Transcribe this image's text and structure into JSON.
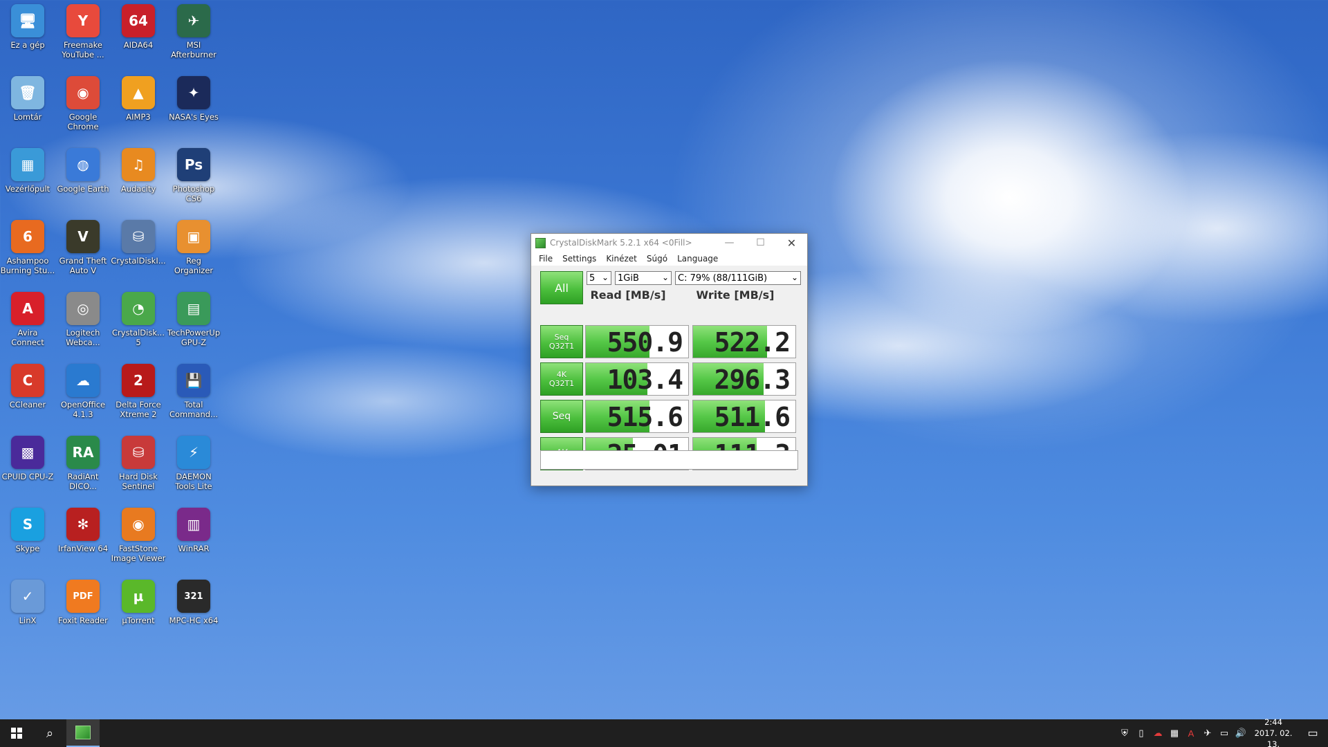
{
  "desktop": {
    "icons": [
      {
        "label": "Ez a gép",
        "glyph": "🖥",
        "color": "#3a8fd8"
      },
      {
        "label": "Freemake YouTube ...",
        "glyph": "Y",
        "color": "#e84a3c"
      },
      {
        "label": "AIDA64",
        "glyph": "64",
        "color": "#c8202a"
      },
      {
        "label": "MSI Afterburner",
        "glyph": "✈",
        "color": "#2b6a4a"
      },
      {
        "label": "Lomtár",
        "glyph": "🗑",
        "color": "#7fb6e0"
      },
      {
        "label": "Google Chrome",
        "glyph": "◉",
        "color": "#dd4b39"
      },
      {
        "label": "AIMP3",
        "glyph": "▲",
        "color": "#f0a020"
      },
      {
        "label": "NASA's Eyes",
        "glyph": "✦",
        "color": "#1b2a5a"
      },
      {
        "label": "Vezérlőpult",
        "glyph": "▦",
        "color": "#3a9ad8"
      },
      {
        "label": "Google Earth",
        "glyph": "◍",
        "color": "#3a7ad8"
      },
      {
        "label": "Audacity",
        "glyph": "♫",
        "color": "#e88a20"
      },
      {
        "label": "Photoshop CS6",
        "glyph": "Ps",
        "color": "#1f3f77"
      },
      {
        "label": "Ashampoo Burning Stu...",
        "glyph": "6",
        "color": "#e86a20"
      },
      {
        "label": "Grand Theft Auto V",
        "glyph": "V",
        "color": "#3a3a2a"
      },
      {
        "label": "CrystalDiskI...",
        "glyph": "⛁",
        "color": "#5a7aa8"
      },
      {
        "label": "Reg Organizer",
        "glyph": "▣",
        "color": "#e89030"
      },
      {
        "label": "Avira Connect",
        "glyph": "A",
        "color": "#d8202a"
      },
      {
        "label": "Logitech Webca...",
        "glyph": "◎",
        "color": "#8a8a8a"
      },
      {
        "label": "CrystalDisk... 5",
        "glyph": "◔",
        "color": "#4aa84a"
      },
      {
        "label": "TechPowerUp GPU-Z",
        "glyph": "▤",
        "color": "#3a9a5a"
      },
      {
        "label": "CCleaner",
        "glyph": "C",
        "color": "#d83a2a"
      },
      {
        "label": "OpenOffice 4.1.3",
        "glyph": "☁",
        "color": "#2a7ad0"
      },
      {
        "label": "Delta Force Xtreme 2",
        "glyph": "2",
        "color": "#b81a1a"
      },
      {
        "label": "Total Command...",
        "glyph": "💾",
        "color": "#2a5ab8"
      },
      {
        "label": "CPUID CPU-Z",
        "glyph": "▩",
        "color": "#4a2a9a"
      },
      {
        "label": "RadiAnt DICO...",
        "glyph": "RA",
        "color": "#2a8a4a"
      },
      {
        "label": "Hard Disk Sentinel",
        "glyph": "⛁",
        "color": "#c83a3a"
      },
      {
        "label": "DAEMON Tools Lite",
        "glyph": "⚡",
        "color": "#2a8ad8"
      },
      {
        "label": "Skype",
        "glyph": "S",
        "color": "#1aa0e0"
      },
      {
        "label": "IrfanView 64",
        "glyph": "✻",
        "color": "#b82020"
      },
      {
        "label": "FastStone Image Viewer",
        "glyph": "◉",
        "color": "#e87a20"
      },
      {
        "label": "WinRAR",
        "glyph": "▥",
        "color": "#7a2a8a"
      },
      {
        "label": "LinX",
        "glyph": "✓",
        "color": "#6a9ad8"
      },
      {
        "label": "Foxit Reader",
        "glyph": "PDF",
        "color": "#f07a20"
      },
      {
        "label": "µTorrent",
        "glyph": "µ",
        "color": "#5ab82a"
      },
      {
        "label": "MPC-HC x64",
        "glyph": "321",
        "color": "#2a2a2a"
      }
    ]
  },
  "window": {
    "title": "CrystalDiskMark 5.2.1 x64 <0Fill>",
    "minimize": "—",
    "maximize": "☐",
    "close": "✕",
    "menu": [
      "File",
      "Settings",
      "Kinézet",
      "Súgó",
      "Language"
    ],
    "all_label": "All",
    "count": "5",
    "size": "1GiB",
    "drive": "C: 79% (88/111GiB)",
    "read_header": "Read [MB/s]",
    "write_header": "Write [MB/s]",
    "rows": [
      {
        "label1": "Seq",
        "label2": "Q32T1",
        "read": "550.9",
        "write": "522.2",
        "read_level": 0.62,
        "write_level": 0.72
      },
      {
        "label1": "4K",
        "label2": "Q32T1",
        "read": "103.4",
        "write": "296.3",
        "read_level": 0.6,
        "write_level": 0.69
      },
      {
        "label1": "Seq",
        "label2": "",
        "read": "515.6",
        "write": "511.6",
        "read_level": 0.62,
        "write_level": 0.7
      },
      {
        "label1": "4K",
        "label2": "",
        "read": "25.01",
        "write": "111.3",
        "read_level": 0.46,
        "write_level": 0.62
      }
    ],
    "comment": ""
  },
  "taskbar": {
    "search_icon": "⌕",
    "tray": [
      "⛨",
      "▯",
      "☁",
      "▦",
      "A",
      "✈",
      "▭",
      "🔊"
    ],
    "time": "2:44",
    "date": "2017. 02. 13.",
    "notification_icon": "▭"
  }
}
